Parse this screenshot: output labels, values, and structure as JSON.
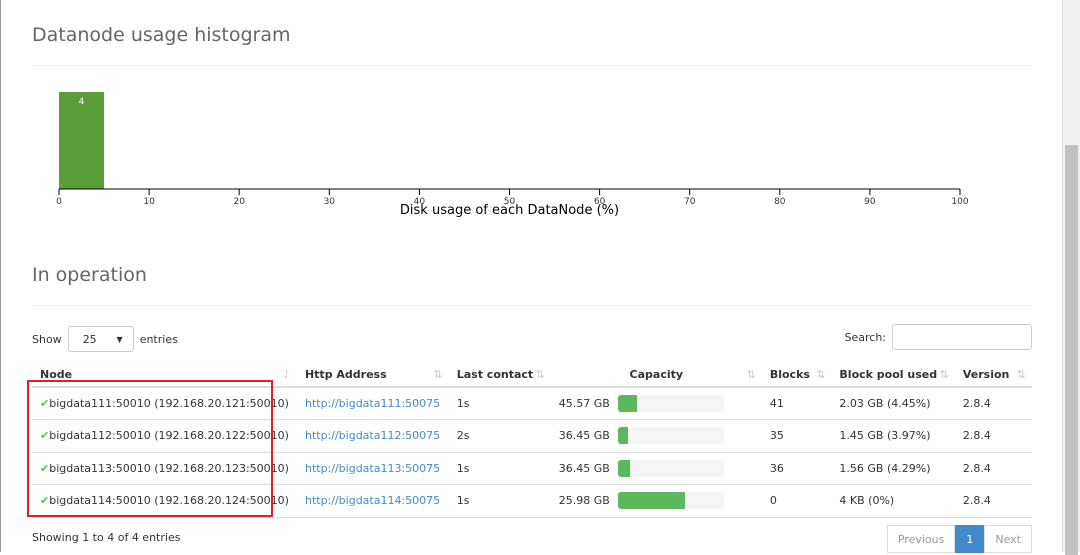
{
  "histogram": {
    "title": "Datanode usage histogram",
    "chart_data": {
      "type": "bar",
      "xlabel": "Disk usage of each DataNode (%)",
      "xlim": [
        0,
        100
      ],
      "xticks": [
        "0",
        "10",
        "20",
        "30",
        "40",
        "50",
        "60",
        "70",
        "80",
        "90",
        "100"
      ],
      "bins": [
        {
          "x0": 0,
          "x1": 5,
          "count": 4
        }
      ],
      "bar_color": "#5a9e3a"
    }
  },
  "operation": {
    "title": "In operation",
    "show_label": "Show",
    "entries_label": "entries",
    "page_size": "25",
    "search_label": "Search:",
    "columns": [
      "Node",
      "Http Address",
      "Last contact",
      "Capacity",
      "Blocks",
      "Block pool used",
      "Version"
    ],
    "rows": [
      {
        "node": "bigdata111:50010 (192.168.20.121:50010)",
        "http": "http://bigdata111:50075",
        "last": "1s",
        "capacity": "45.57 GB",
        "used_pct": 18,
        "blocks": "41",
        "pool": "2.03 GB (4.45%)",
        "version": "2.8.4"
      },
      {
        "node": "bigdata112:50010 (192.168.20.122:50010)",
        "http": "http://bigdata112:50075",
        "last": "2s",
        "capacity": "36.45 GB",
        "used_pct": 10,
        "blocks": "35",
        "pool": "1.45 GB (3.97%)",
        "version": "2.8.4"
      },
      {
        "node": "bigdata113:50010 (192.168.20.123:50010)",
        "http": "http://bigdata113:50075",
        "last": "1s",
        "capacity": "36.45 GB",
        "used_pct": 11,
        "blocks": "36",
        "pool": "1.56 GB (4.29%)",
        "version": "2.8.4"
      },
      {
        "node": "bigdata114:50010 (192.168.20.124:50010)",
        "http": "http://bigdata114:50075",
        "last": "1s",
        "capacity": "25.98 GB",
        "used_pct": 63,
        "blocks": "0",
        "pool": "4 KB (0%)",
        "version": "2.8.4"
      }
    ],
    "info": "Showing 1 to 4 of 4 entries",
    "pager": {
      "prev": "Previous",
      "page": "1",
      "next": "Next"
    }
  }
}
